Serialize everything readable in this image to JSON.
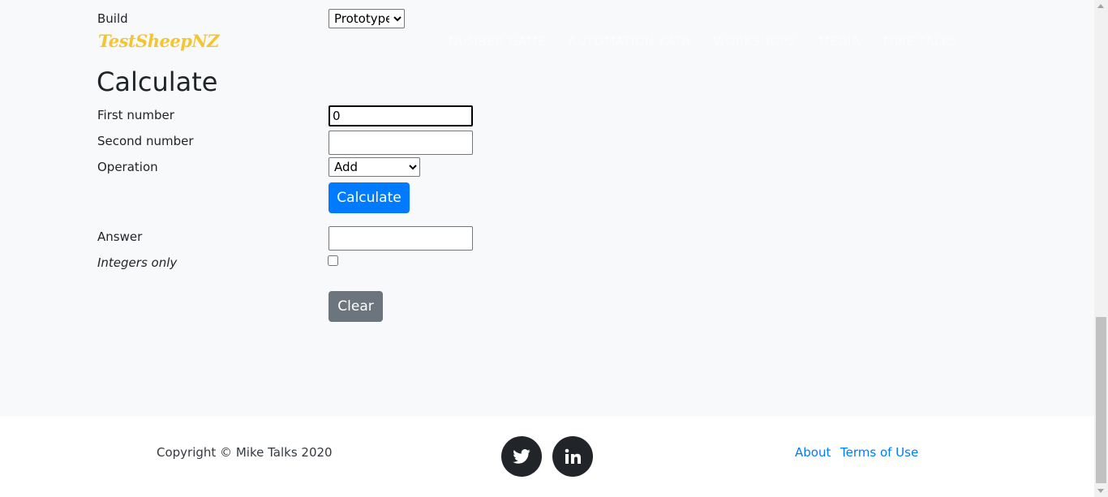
{
  "brand": {
    "logo": "TestSheepNZ"
  },
  "nav": {
    "items": [
      "NUMBER GAME",
      "AUTOMATION KATA",
      "WORKSHOPS",
      "MEDIA",
      "MIKE TALKS"
    ]
  },
  "build": {
    "label": "Build",
    "selected": "Prototype"
  },
  "form": {
    "title": "Calculate",
    "first_number": {
      "label": "First number",
      "value": "0"
    },
    "second_number": {
      "label": "Second number",
      "value": ""
    },
    "operation": {
      "label": "Operation",
      "selected": "Add"
    },
    "calculate_button": "Calculate",
    "answer": {
      "label": "Answer",
      "value": ""
    },
    "integers_only": {
      "label": "Integers only",
      "checked": false
    },
    "clear_button": "Clear"
  },
  "footer": {
    "copyright": "Copyright © Mike Talks 2020",
    "social": [
      "twitter-icon",
      "linkedin-icon"
    ],
    "links": [
      "About",
      "Terms of Use"
    ]
  },
  "colors": {
    "primary": "#007bff",
    "secondary": "#6c757d",
    "logo": "#f5c531",
    "background": "#f8f9fa"
  }
}
